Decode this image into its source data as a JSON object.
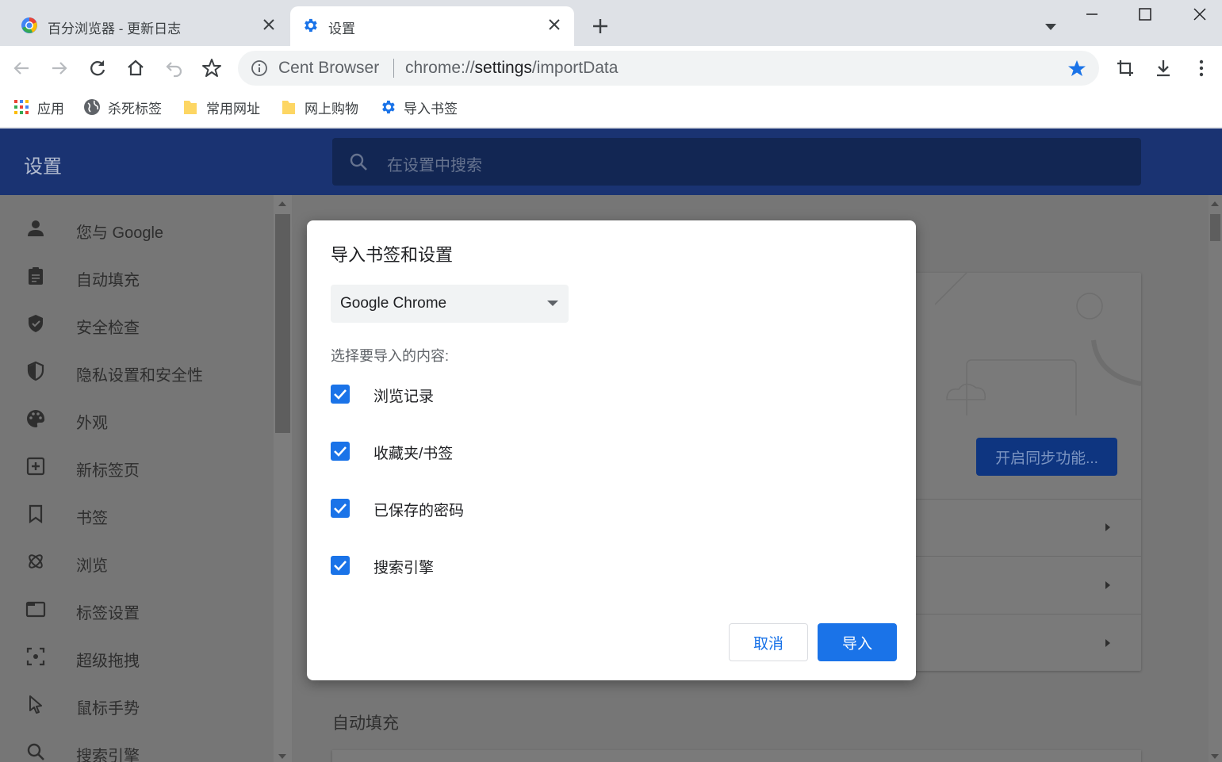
{
  "colors": {
    "accent": "#1a73e8",
    "settings_header": "#1a3372",
    "tabstrip": "#dee1e6",
    "scrim_page": "#767676"
  },
  "tabs": [
    {
      "title": "百分浏览器 - 更新日志",
      "icon": "cent-browser-logo-icon",
      "active": false
    },
    {
      "title": "设置",
      "icon": "gear-icon",
      "active": true
    }
  ],
  "toolbar": {
    "site_name": "Cent Browser",
    "url_prefix": "chrome://",
    "url_host": "settings",
    "url_path": "/importData"
  },
  "bookmarks": [
    {
      "label": "应用",
      "icon": "apps-grid-icon"
    },
    {
      "label": "杀死标签",
      "icon": "globe-icon"
    },
    {
      "label": "常用网址",
      "icon": "folder-icon"
    },
    {
      "label": "网上购物",
      "icon": "folder-icon"
    },
    {
      "label": "导入书签",
      "icon": "gear-icon"
    }
  ],
  "settings": {
    "title": "设置",
    "search_placeholder": "在设置中搜索",
    "sync_button": "开启同步功能...",
    "autofill_heading": "自动填充",
    "nav": [
      {
        "label": "您与 Google",
        "icon": "person-icon"
      },
      {
        "label": "自动填充",
        "icon": "clipboard-icon"
      },
      {
        "label": "安全检查",
        "icon": "shield-check-icon"
      },
      {
        "label": "隐私设置和安全性",
        "icon": "shield-half-icon"
      },
      {
        "label": "外观",
        "icon": "palette-icon"
      },
      {
        "label": "新标签页",
        "icon": "new-tab-icon"
      },
      {
        "label": "书签",
        "icon": "bookmark-icon"
      },
      {
        "label": "浏览",
        "icon": "browse-icon"
      },
      {
        "label": "标签设置",
        "icon": "tab-icon"
      },
      {
        "label": "超级拖拽",
        "icon": "drag-icon"
      },
      {
        "label": "鼠标手势",
        "icon": "cursor-icon"
      },
      {
        "label": "搜索引擎",
        "icon": "search-icon"
      }
    ]
  },
  "dialog": {
    "title": "导入书签和设置",
    "source_selected": "Google Chrome",
    "subtitle": "选择要导入的内容:",
    "options": [
      {
        "label": "浏览记录",
        "checked": true
      },
      {
        "label": "收藏夹/书签",
        "checked": true
      },
      {
        "label": "已保存的密码",
        "checked": true
      },
      {
        "label": "搜索引擎",
        "checked": true
      }
    ],
    "cancel_label": "取消",
    "import_label": "导入"
  }
}
